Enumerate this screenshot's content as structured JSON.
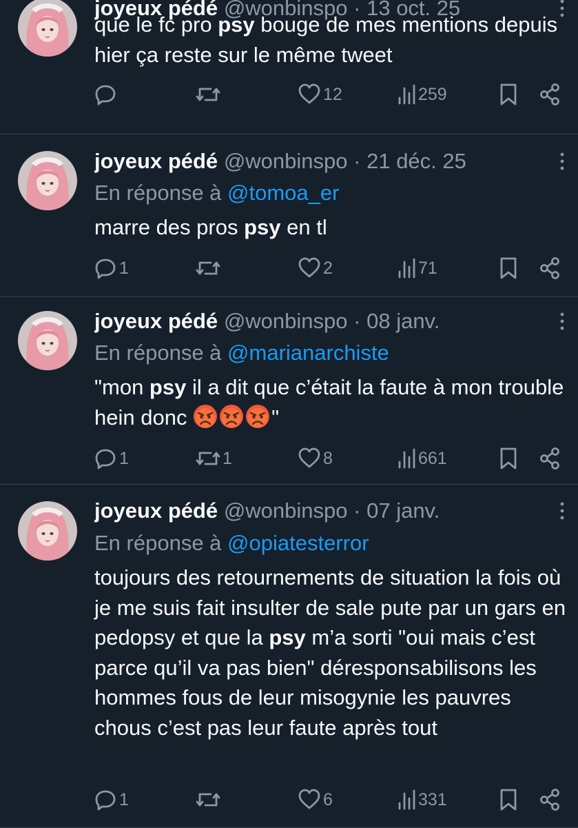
{
  "tweets": [
    {
      "name": "joyeux pédé",
      "handle": "@wonbinspo",
      "sep": "·",
      "date": "13 oct. 25",
      "reply_prefix": "",
      "reply_to": "",
      "body": [
        {
          "text": "que le fc pro ",
          "bold": false
        },
        {
          "text": "psy",
          "bold": true
        },
        {
          "text": " bouge de mes mentions depuis hier ça reste sur le même tweet",
          "bold": false
        }
      ],
      "emojis": [],
      "trailing": "",
      "stats": {
        "replies": "",
        "retweets": "",
        "likes": "12",
        "views": "259"
      }
    },
    {
      "name": "joyeux pédé",
      "handle": "@wonbinspo",
      "sep": "·",
      "date": "21 déc. 25",
      "reply_prefix": "En réponse à ",
      "reply_to": "@tomoa_er",
      "body": [
        {
          "text": "marre des pros ",
          "bold": false
        },
        {
          "text": "psy",
          "bold": true
        },
        {
          "text": " en tl",
          "bold": false
        }
      ],
      "emojis": [],
      "trailing": "",
      "stats": {
        "replies": "1",
        "retweets": "",
        "likes": "2",
        "views": "71"
      }
    },
    {
      "name": "joyeux pédé",
      "handle": "@wonbinspo",
      "sep": "·",
      "date": "08 janv.",
      "reply_prefix": "En réponse à ",
      "reply_to": "@marianarchiste",
      "body": [
        {
          "text": "\"mon ",
          "bold": false
        },
        {
          "text": "psy",
          "bold": true
        },
        {
          "text": " il a dit que c’était la faute à mon trouble hein donc ",
          "bold": false
        }
      ],
      "emojis": [
        "angry-face",
        "angry-face",
        "angry-face"
      ],
      "trailing": "\"",
      "stats": {
        "replies": "1",
        "retweets": "1",
        "likes": "8",
        "views": "661"
      }
    },
    {
      "name": "joyeux pédé",
      "handle": "@wonbinspo",
      "sep": "·",
      "date": "07 janv.",
      "reply_prefix": "En réponse à ",
      "reply_to": "@opiatesterror",
      "body": [
        {
          "text": "toujours des retournements de situation la fois où je me suis fait insulter de sale pute par un gars en pedopsy et que la ",
          "bold": false
        },
        {
          "text": "psy",
          "bold": true
        },
        {
          "text": " m’a sorti \"oui mais c’est parce qu’il va pas bien\" déresponsabilisons les hommes fous de leur misogynie les pauvres chous c’est pas leur faute après tout",
          "bold": false
        }
      ],
      "emojis": [],
      "trailing": "",
      "stats": {
        "replies": "1",
        "retweets": "",
        "likes": "6",
        "views": "331"
      }
    }
  ],
  "icons": {
    "reply": "speech-bubble-icon",
    "retweet": "retweet-arrows-icon",
    "like": "heart-icon",
    "views": "bar-chart-icon",
    "bookmark": "bookmark-icon",
    "share": "share-icon",
    "more": "vertical-dots-icon"
  },
  "colors": {
    "background": "#15202b",
    "text": "#f7f9f9",
    "secondary": "#8b98a5",
    "link": "#1d9bf0",
    "divider": "#38444d"
  }
}
